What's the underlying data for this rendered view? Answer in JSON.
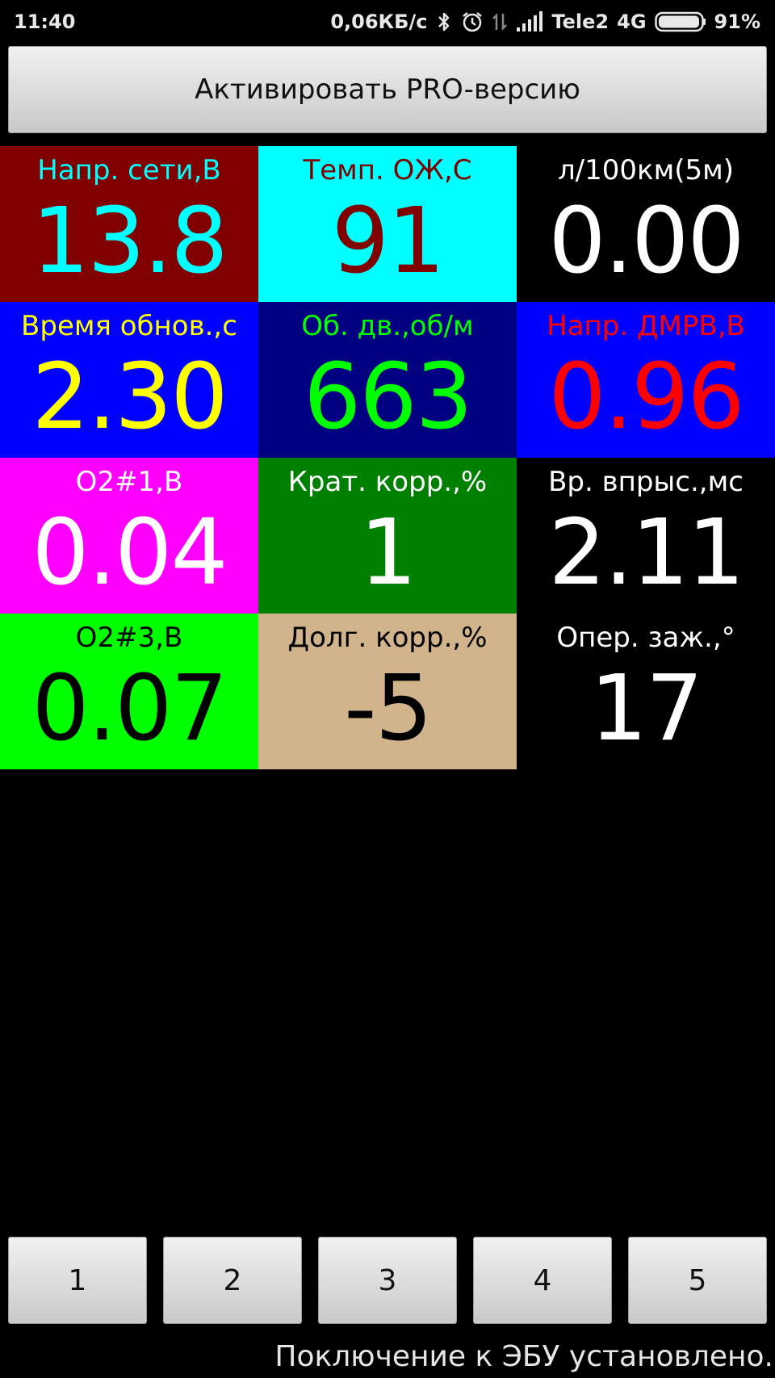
{
  "statusbar": {
    "time": "11:40",
    "speed": "0,06КБ/с",
    "carrier": "Tele2",
    "network": "4G",
    "battery": "91%",
    "icons": [
      "bluetooth-icon",
      "alarm-icon",
      "data-arrows-icon",
      "signal-icon",
      "battery-icon"
    ]
  },
  "pro_button": "Активировать PRO-версию",
  "cells": [
    {
      "label": "Напр. сети,В",
      "value": "13.8",
      "bg": "#800000",
      "label_color": "#00ffff",
      "value_color": "#00ffff"
    },
    {
      "label": "Темп. ОЖ,С",
      "value": "91",
      "bg": "#00ffff",
      "label_color": "#800000",
      "value_color": "#800000"
    },
    {
      "label": "л/100км(5м)",
      "value": "0.00",
      "bg": "#000000",
      "label_color": "#ffffff",
      "value_color": "#ffffff"
    },
    {
      "label": "Время обнов.,с",
      "value": "2.30",
      "bg": "#0000ff",
      "label_color": "#ffff00",
      "value_color": "#ffff00"
    },
    {
      "label": "Об. дв.,об/м",
      "value": "663",
      "bg": "#000080",
      "label_color": "#00ff00",
      "value_color": "#00ff00"
    },
    {
      "label": "Напр. ДМРВ,В",
      "value": "0.96",
      "bg": "#0000ff",
      "label_color": "#ff0000",
      "value_color": "#ff0000"
    },
    {
      "label": "O2#1,В",
      "value": "0.04",
      "bg": "#ff00ff",
      "label_color": "#ffffff",
      "value_color": "#ffffff"
    },
    {
      "label": "Крат. корр.,%",
      "value": "1",
      "bg": "#008000",
      "label_color": "#ffffff",
      "value_color": "#ffffff"
    },
    {
      "label": "Вр. впрыс.,мс",
      "value": "2.11",
      "bg": "#000000",
      "label_color": "#ffffff",
      "value_color": "#ffffff"
    },
    {
      "label": "O2#3,В",
      "value": "0.07",
      "bg": "#00ff00",
      "label_color": "#000000",
      "value_color": "#000000"
    },
    {
      "label": "Долг. корр.,%",
      "value": "-5",
      "bg": "#d2b48c",
      "label_color": "#000000",
      "value_color": "#000000"
    },
    {
      "label": "Опер. заж.,°",
      "value": "17",
      "bg": "#000000",
      "label_color": "#ffffff",
      "value_color": "#ffffff"
    }
  ],
  "pages": [
    "1",
    "2",
    "3",
    "4",
    "5"
  ],
  "connection_status": "Поключение к ЭБУ установлено."
}
